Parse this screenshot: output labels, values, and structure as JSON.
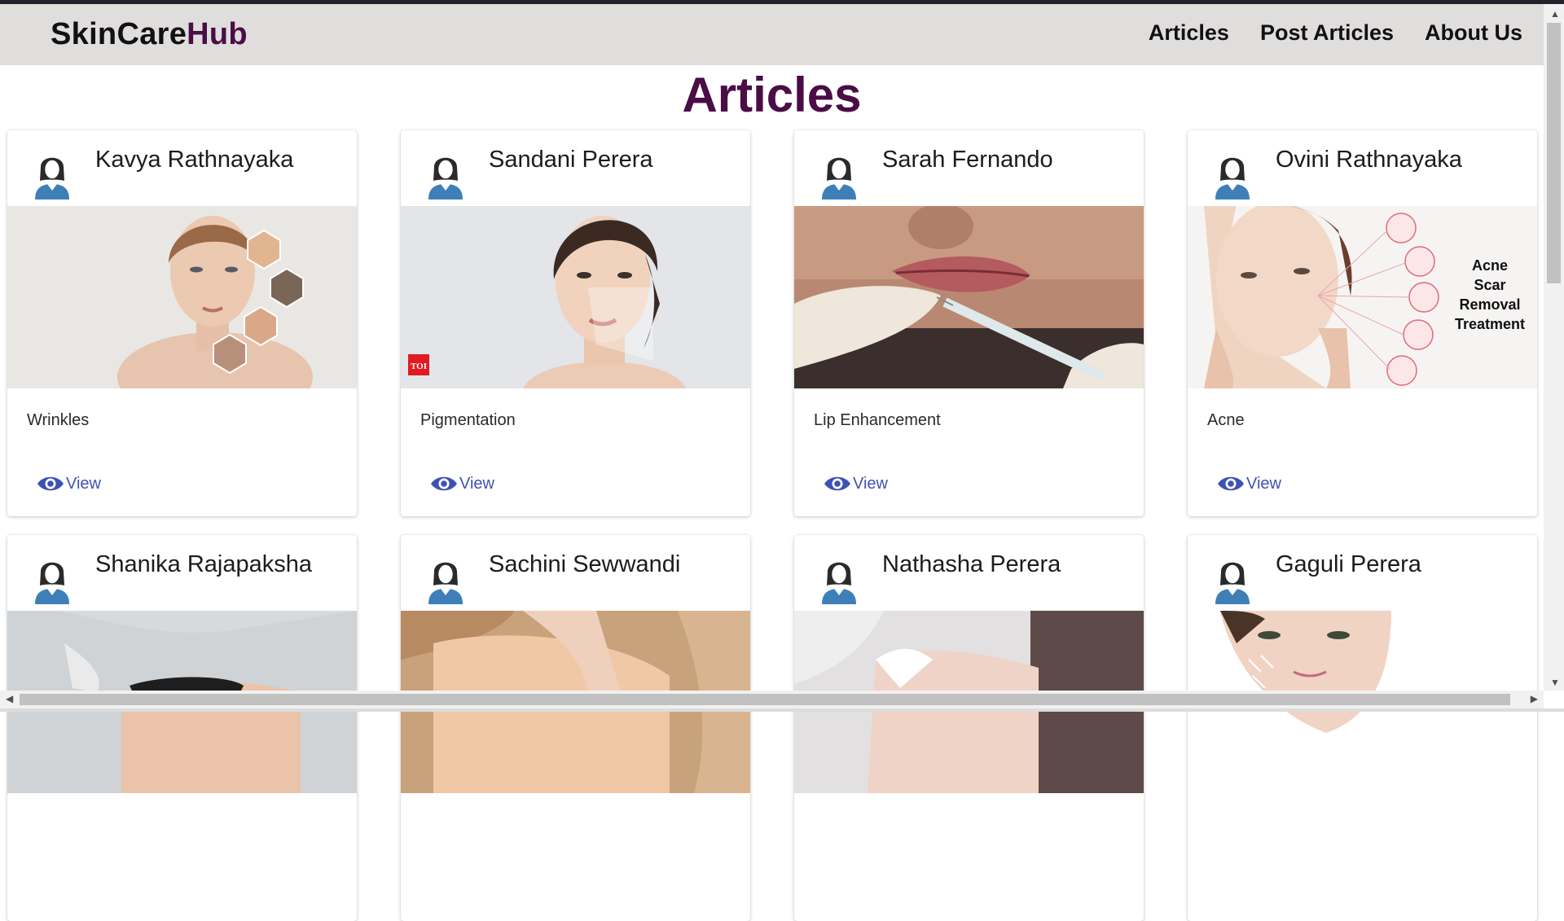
{
  "brand": {
    "part1": "SkinCare",
    "part2": "Hub"
  },
  "nav": {
    "articles": "Articles",
    "post": "Post Articles",
    "about": "About Us"
  },
  "page_title": "Articles",
  "cards": [
    {
      "author": "Kavya Rathnayaka",
      "topic": "Wrinkles",
      "view": "View"
    },
    {
      "author": "Sandani Perera",
      "topic": "Pigmentation",
      "view": "View",
      "badge": "TOI"
    },
    {
      "author": "Sarah Fernando",
      "topic": "Lip Enhancement",
      "view": "View"
    },
    {
      "author": "Ovini Rathnayaka",
      "topic": "Acne",
      "view": "View",
      "image_text": [
        "Acne",
        "Scar",
        "Removal",
        "Treatment"
      ]
    },
    {
      "author": "Shanika Rajapaksha"
    },
    {
      "author": "Sachini Sewwandi"
    },
    {
      "author": "Nathasha Perera"
    },
    {
      "author": "Gaguli Perera"
    }
  ],
  "colors": {
    "brand_accent": "#4a0d45",
    "link": "#3f51b5",
    "navbar_bg": "#e0dddd"
  },
  "icons": {
    "avatar": "female-user-icon",
    "view": "eye-icon"
  }
}
